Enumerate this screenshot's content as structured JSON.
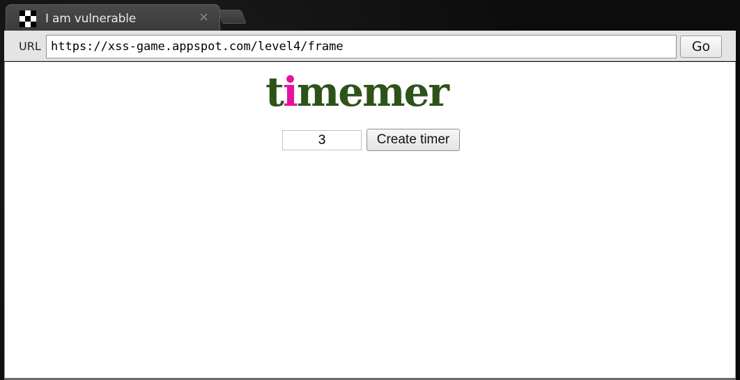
{
  "browser": {
    "tab": {
      "title": "I am vulnerable",
      "close_glyph": "×",
      "favicon": "checker-icon"
    },
    "toolbar": {
      "url_label": "URL",
      "url_value": "https://xss-game.appspot.com/level4/frame",
      "go_label": "Go"
    }
  },
  "page": {
    "logo": {
      "letters": [
        {
          "char": "t",
          "color": "#2e5319"
        },
        {
          "char": "i",
          "color": "#e8119e"
        },
        {
          "char": "m",
          "color": "#2e5319"
        },
        {
          "char": "e",
          "color": "#2e5319"
        },
        {
          "char": "m",
          "color": "#2e5319"
        },
        {
          "char": "e",
          "color": "#2e5319"
        },
        {
          "char": "r",
          "color": "#2e5319"
        }
      ]
    },
    "timer_input_value": "3",
    "create_button_label": "Create timer"
  },
  "colors": {
    "logo_green": "#2e5319",
    "logo_pink": "#e8119e"
  }
}
